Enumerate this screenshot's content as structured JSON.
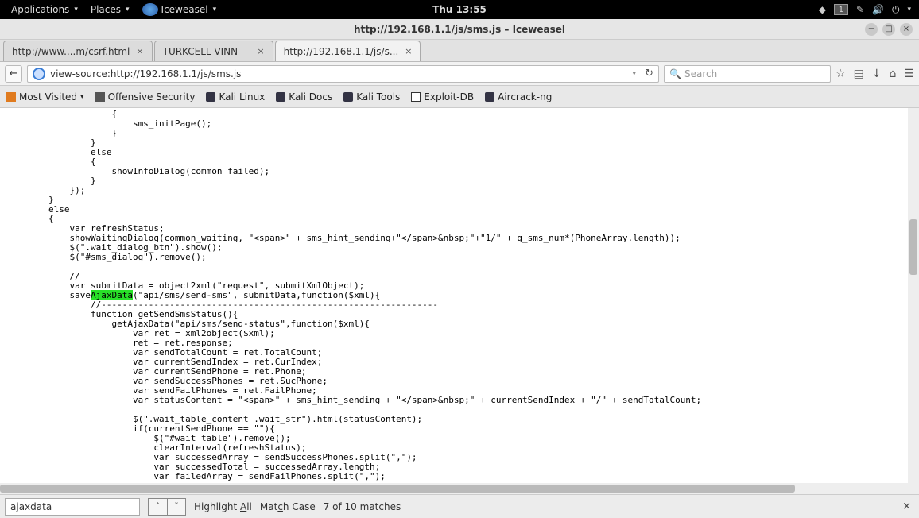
{
  "panel": {
    "apps_label": "Applications",
    "places_label": "Places",
    "browser_label": "Iceweasel",
    "clock": "Thu 13:55",
    "workspace": "1"
  },
  "window": {
    "title": "http://192.168.1.1/js/sms.js – Iceweasel"
  },
  "tabs": [
    {
      "label": "http://www....m/csrf.html"
    },
    {
      "label": "TURKCELL VINN"
    },
    {
      "label": "http://192.168.1.1/js/s..."
    }
  ],
  "url": "view-source:http://192.168.1.1/js/sms.js",
  "search": {
    "placeholder": "Search"
  },
  "bookmarks": [
    "Most Visited",
    "Offensive Security",
    "Kali Linux",
    "Kali Docs",
    "Kali Tools",
    "Exploit-DB",
    "Aircrack-ng"
  ],
  "source": {
    "before_hl": "            {\n                sms_initPage();\n            }\n        }\n        else\n        {\n            showInfoDialog(common_failed);\n        }\n    });\n}\nelse\n{\n    var refreshStatus;\n    showWaitingDialog(common_waiting, \"<span>\" + sms_hint_sending+\"</span>&nbsp;\"+\"1/\" + g_sms_num*(PhoneArray.length));\n    $(\".wait_dialog_btn\").show();\n    $(\"#sms_dialog\").remove();\n\n    //\n    var submitData = object2xml(\"request\", submitXmlObject);\n    save",
    "hl": "AjaxData",
    "after_hl": "(\"api/sms/send-sms\", submitData,function($xml){\n        //----------------------------------------------------------------\n        function getSendSmsStatus(){\n            getAjaxData(\"api/sms/send-status\",function($xml){\n                var ret = xml2object($xml);\n                ret = ret.response;\n                var sendTotalCount = ret.TotalCount;\n                var currentSendIndex = ret.CurIndex;\n                var currentSendPhone = ret.Phone;\n                var sendSuccessPhones = ret.SucPhone;\n                var sendFailPhones = ret.FailPhone;\n                var statusContent = \"<span>\" + sms_hint_sending + \"</span>&nbsp;\" + currentSendIndex + \"/\" + sendTotalCount;\n\n                $(\".wait_table_content .wait_str\").html(statusContent);\n                if(currentSendPhone == \"\"){\n                    $(\"#wait_table\").remove();\n                    clearInterval(refreshStatus);\n                    var successedArray = sendSuccessPhones.split(\",\");\n                    var successedTotal = successedArray.length;\n                    var failedArray = sendFailPhones.split(\",\");"
  },
  "find": {
    "query": "ajaxdata",
    "highlight": "Highlight All",
    "matchcase": "Match Case",
    "status": "7 of 10 matches"
  }
}
